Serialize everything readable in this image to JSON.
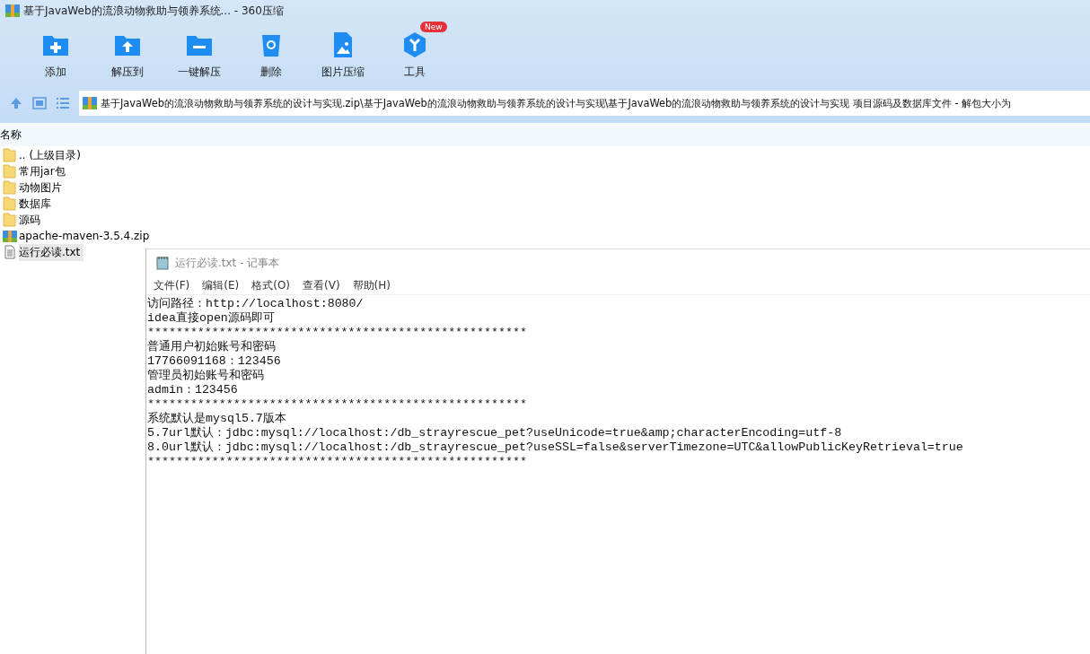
{
  "window": {
    "title": "基于JavaWeb的流浪动物救助与领养系统... - 360压缩"
  },
  "toolbar": [
    {
      "label": "添加",
      "kind": "add"
    },
    {
      "label": "解压到",
      "kind": "extract"
    },
    {
      "label": "一键解压",
      "kind": "oneclick"
    },
    {
      "label": "删除",
      "kind": "delete"
    },
    {
      "label": "图片压缩",
      "kind": "image"
    },
    {
      "label": "工具",
      "kind": "tools",
      "badge": "New"
    }
  ],
  "path": "基于JavaWeb的流浪动物救助与领养系统的设计与实现.zip\\基于JavaWeb的流浪动物救助与领养系统的设计与实现\\基于JavaWeb的流浪动物救助与领养系统的设计与实现 项目源码及数据库文件 - 解包大小为",
  "table": {
    "columns": [
      "名称"
    ],
    "rows": [
      {
        "name": ".. (上级目录)",
        "kind": "folder",
        "selected": false
      },
      {
        "name": "常用jar包",
        "kind": "folder",
        "selected": false
      },
      {
        "name": "动物图片",
        "kind": "folder",
        "selected": false
      },
      {
        "name": "数据库",
        "kind": "folder",
        "selected": false
      },
      {
        "name": "源码",
        "kind": "folder",
        "selected": false
      },
      {
        "name": "apache-maven-3.5.4.zip",
        "kind": "zip",
        "selected": false
      },
      {
        "name": "运行必读.txt",
        "kind": "txt",
        "selected": true
      }
    ]
  },
  "notepad": {
    "title": "运行必读.txt - 记事本",
    "menu": [
      "文件(F)",
      "编辑(E)",
      "格式(O)",
      "查看(V)",
      "帮助(H)"
    ],
    "lines": [
      "访问路径：http://localhost:8080/",
      "idea直接open源码即可",
      "*****************************************************",
      "普通用户初始账号和密码",
      "17766091168：123456",
      "管理员初始账号和密码",
      "admin：123456",
      "*****************************************************",
      "系统默认是mysql5.7版本",
      "5.7url默认：jdbc:mysql://localhost:/db_strayrescue_pet?useUnicode=true&amp;characterEncoding=utf-8",
      "8.0url默认：jdbc:mysql://localhost:/db_strayrescue_pet?useSSL=false&serverTimezone=UTC&allowPublicKeyRetrieval=true",
      "*****************************************************"
    ]
  }
}
